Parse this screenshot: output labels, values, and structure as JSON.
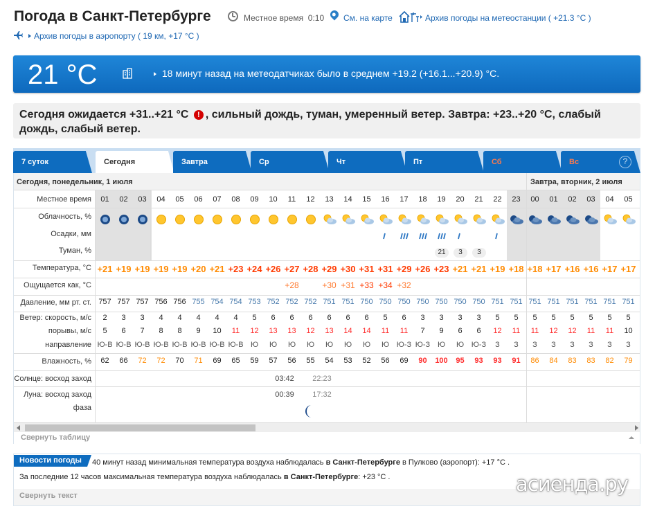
{
  "header": {
    "title": "Погода в Санкт-Петербурге",
    "local_time_label": "Местное время",
    "local_time_value": "0:10",
    "map_link": "См. на карте",
    "station_link": "Архив погоды на метеостанции ( +21.3 °C )",
    "airport_link": "Архив погоды в аэропорту ( 19 км, +17 °C )"
  },
  "banner": {
    "temp": "21 °C",
    "text": "18 минут назад на метеодатчиках было в среднем +19.2 (+16.1...+20.9) °C."
  },
  "forecast": {
    "part1": "Сегодня ожидается +31..+21 °C",
    "warn_icon": "!",
    "part2": ", сильный дождь, туман, умеренный ветер. Завтра: +23..+20 °C, слабый дождь, слабый ветер."
  },
  "tabs": [
    {
      "label": "7 суток",
      "active": false,
      "weekend": false
    },
    {
      "label": "Сегодня",
      "active": true,
      "weekend": false
    },
    {
      "label": "Завтра",
      "active": false,
      "weekend": false
    },
    {
      "label": "Ср",
      "active": false,
      "weekend": false
    },
    {
      "label": "Чт",
      "active": false,
      "weekend": false
    },
    {
      "label": "Пт",
      "active": false,
      "weekend": false
    },
    {
      "label": "Сб",
      "active": false,
      "weekend": true
    },
    {
      "label": "Вс",
      "active": false,
      "weekend": true
    }
  ],
  "help_icon": "?",
  "table": {
    "day1_label": "Сегодня, понедельник, 1 июля",
    "day2_label": "Завтра, вторник, 2 июля",
    "row_labels": {
      "time": "Местное время",
      "clouds": "Облачность, %",
      "precip": "Осадки, мм",
      "fog": "Туман, %",
      "temp": "Температура, °C",
      "feels": "Ощущается как, °C",
      "pressure": "Давление, мм рт. ст.",
      "wind_speed": "Ветер: скорость, м/с",
      "gusts": "порывы, м/с",
      "direction": "направление",
      "humidity": "Влажность, %",
      "sun": "Солнце: восход заход",
      "moon": "Луна: восход заход",
      "phase": "фаза"
    },
    "hours": [
      "01",
      "02",
      "03",
      "04",
      "05",
      "06",
      "07",
      "08",
      "09",
      "10",
      "11",
      "12",
      "13",
      "14",
      "15",
      "16",
      "17",
      "18",
      "19",
      "20",
      "21",
      "22",
      "23",
      "00",
      "01",
      "02",
      "03",
      "04",
      "05"
    ],
    "clouds": [
      "night-clear",
      "night-clear",
      "night-clear",
      "sun",
      "sun",
      "sun",
      "sun",
      "sun",
      "sun",
      "sun",
      "sun",
      "sun",
      "sun-cloud",
      "sun-cloud",
      "sun-cloud",
      "sun-cloud",
      "sun-cloud",
      "sun-cloud",
      "sun-cloud",
      "sun-cloud",
      "sun-cloud",
      "sun-cloud",
      "night-cloud",
      "night-cloud",
      "night-cloud",
      "night-cloud",
      "night-cloud",
      "sun-cloud",
      "sun-cloud"
    ],
    "precip": [
      "",
      "",
      "",
      "",
      "",
      "",
      "",
      "",
      "",
      "",
      "",
      "",
      "",
      "",
      "",
      "light",
      "heavy",
      "heavy",
      "heavy",
      "light",
      "",
      "light",
      "",
      "",
      "",
      "",
      "",
      "",
      ""
    ],
    "fog": [
      "",
      "",
      "",
      "",
      "",
      "",
      "",
      "",
      "",
      "",
      "",
      "",
      "",
      "",
      "",
      "",
      "",
      "",
      "21",
      "3",
      "3",
      "",
      "",
      "",
      "",
      "",
      "",
      "",
      ""
    ],
    "temp": [
      "+21",
      "+19",
      "+19",
      "+19",
      "+19",
      "+20",
      "+21",
      "+23",
      "+24",
      "+26",
      "+27",
      "+28",
      "+29",
      "+30",
      "+31",
      "+31",
      "+29",
      "+26",
      "+23",
      "+21",
      "+21",
      "+19",
      "+18",
      "+18",
      "+17",
      "+16",
      "+16",
      "+17",
      "+17"
    ],
    "feels": [
      "",
      "",
      "",
      "",
      "",
      "",
      "",
      "",
      "",
      "",
      "+28",
      "",
      "+30",
      "+31",
      "+33",
      "+34",
      "+32",
      "",
      "",
      "",
      "",
      "",
      "",
      "",
      "",
      "",
      "",
      "",
      ""
    ],
    "pressure": [
      "757",
      "757",
      "757",
      "756",
      "756",
      "755",
      "754",
      "754",
      "753",
      "752",
      "752",
      "752",
      "751",
      "751",
      "750",
      "750",
      "750",
      "750",
      "750",
      "750",
      "750",
      "751",
      "751",
      "751",
      "751",
      "751",
      "751",
      "751",
      "751"
    ],
    "wind_speed": [
      "2",
      "3",
      "3",
      "4",
      "4",
      "4",
      "4",
      "4",
      "5",
      "6",
      "6",
      "6",
      "6",
      "6",
      "6",
      "5",
      "6",
      "3",
      "3",
      "3",
      "3",
      "5",
      "5",
      "5",
      "5",
      "5",
      "5",
      "5",
      "5"
    ],
    "gusts": [
      "5",
      "6",
      "7",
      "8",
      "8",
      "9",
      "10",
      "11",
      "12",
      "13",
      "13",
      "12",
      "13",
      "14",
      "14",
      "11",
      "11",
      "7",
      "9",
      "6",
      "6",
      "12",
      "11",
      "11",
      "12",
      "12",
      "11",
      "11",
      "10"
    ],
    "direction": [
      "Ю-В",
      "Ю-В",
      "Ю-В",
      "Ю-В",
      "Ю-В",
      "Ю-В",
      "Ю-В",
      "Ю-В",
      "Ю",
      "Ю",
      "Ю",
      "Ю",
      "Ю",
      "Ю",
      "Ю",
      "Ю",
      "Ю-З",
      "Ю-З",
      "Ю",
      "Ю",
      "Ю-З",
      "З",
      "З",
      "З",
      "З",
      "З",
      "З",
      "З",
      "З"
    ],
    "humidity": [
      "62",
      "66",
      "72",
      "72",
      "70",
      "71",
      "69",
      "65",
      "59",
      "57",
      "56",
      "55",
      "54",
      "53",
      "52",
      "56",
      "69",
      "90",
      "100",
      "95",
      "93",
      "93",
      "91",
      "86",
      "84",
      "83",
      "83",
      "82",
      "79"
    ],
    "sunrise": "03:42",
    "sunset": "22:23",
    "moonrise": "00:39",
    "moonset": "17:32",
    "colors": {
      "temp_hot": "#ff3a00",
      "temp_warm": "#ff8a00",
      "feels": "#ff7a30",
      "gust_strong": "#ff2b2b",
      "humidity_high": "#ff8a00",
      "humidity_very_high": "#ff2b2b",
      "pressure_blue": "#4477aa",
      "link_blue": "#1f68b3"
    },
    "collapse_label": "Свернуть таблицу"
  },
  "news": {
    "badge": "Новости погоды",
    "line1_prefix": "40 минут назад минимальная температура воздуха наблюдалась ",
    "line1_bold": "в Санкт-Петербурге",
    "line1_suffix": " в Пулково (аэропорт): +17 °C .",
    "line2_prefix": "За последние 12 часов максимальная температура воздуха наблюдалась ",
    "line2_bold": "в Санкт-Петербурге",
    "line2_suffix": ": +23 °C .",
    "collapse_label": "Свернуть текст",
    "watermark": "асиенда.ру"
  }
}
